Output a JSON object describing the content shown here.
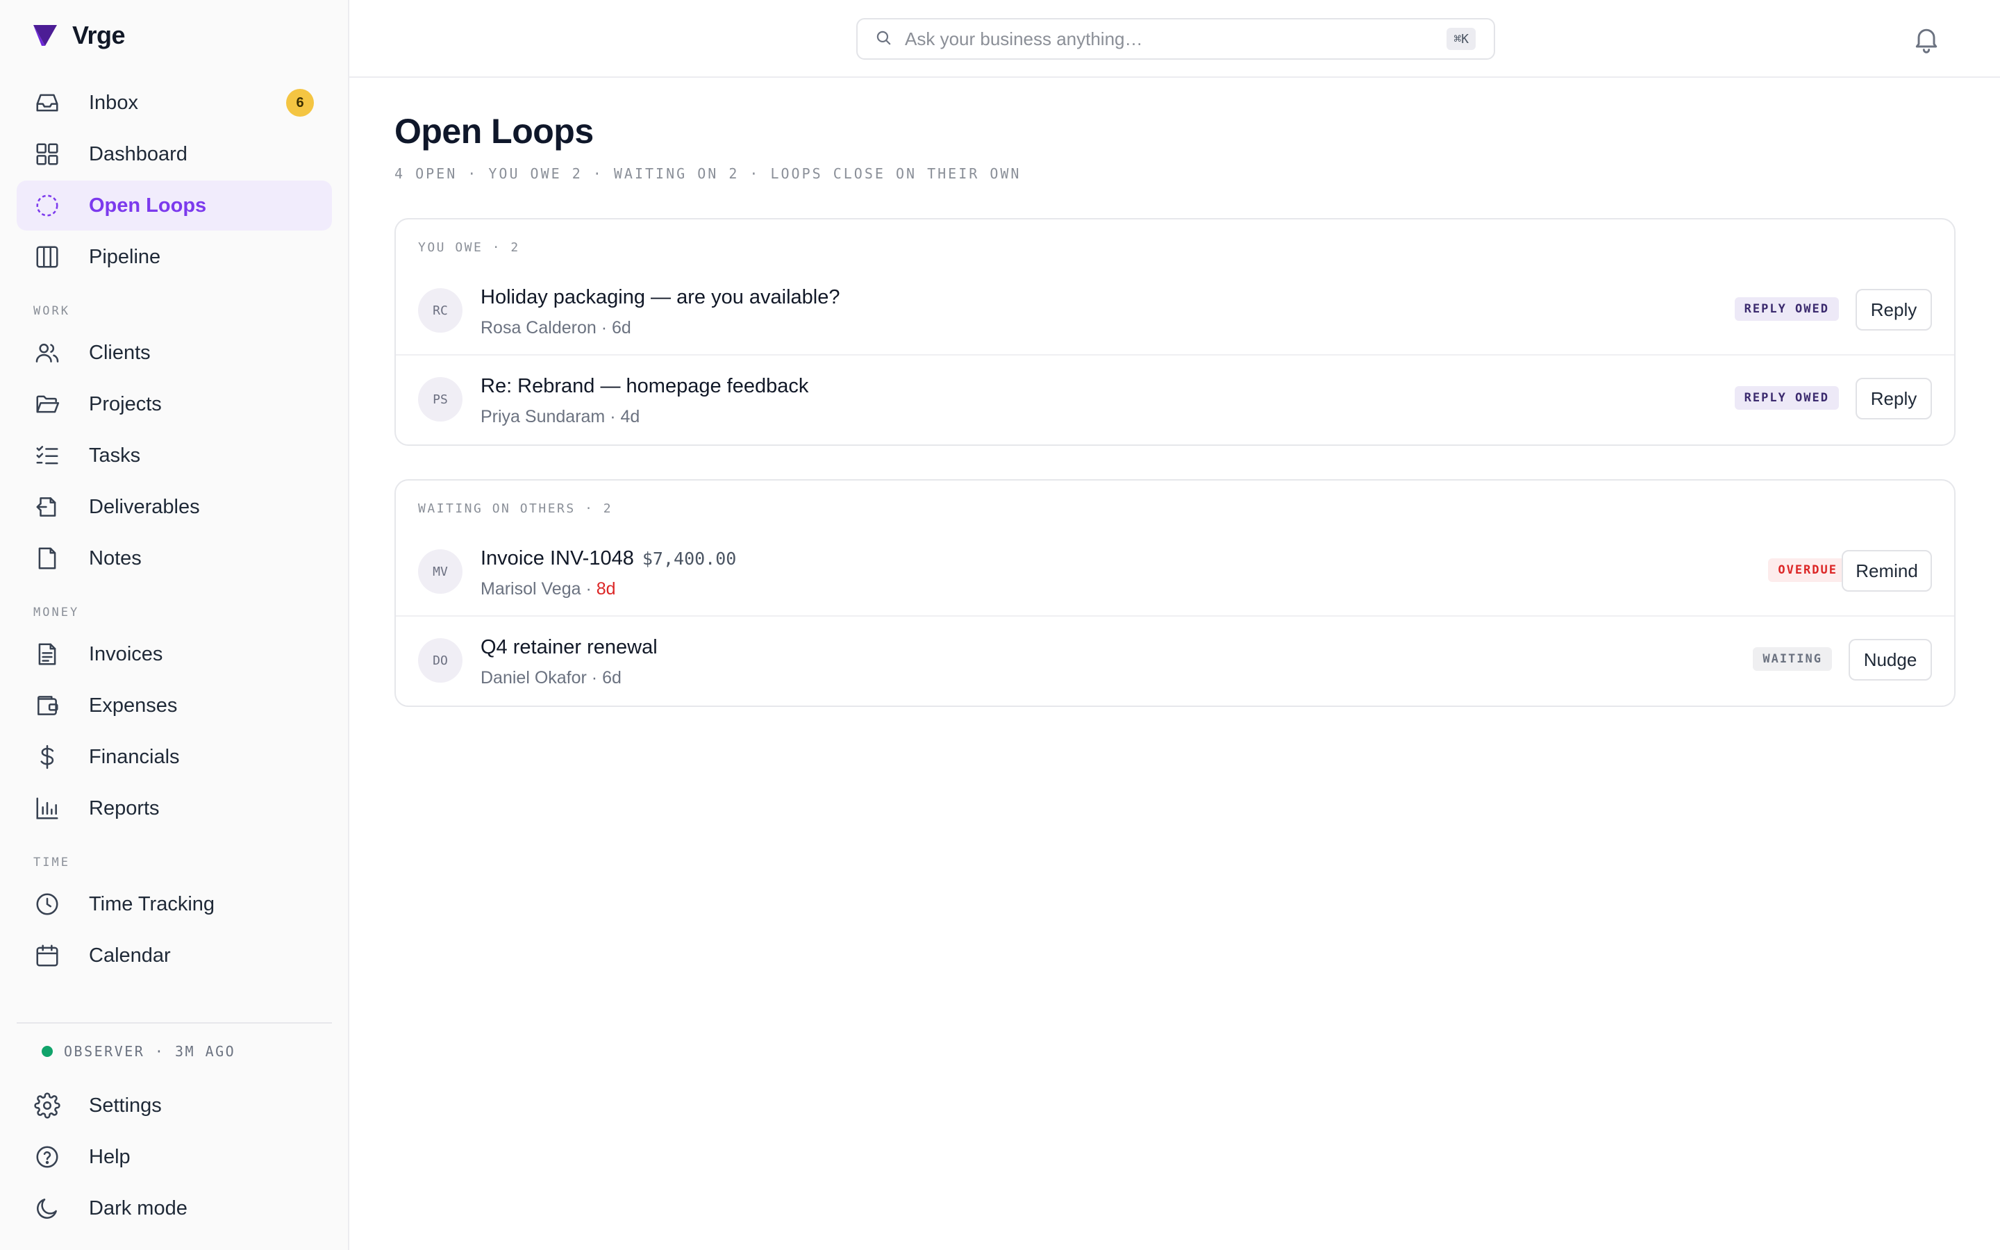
{
  "app": {
    "name": "Vrge"
  },
  "colors": {
    "accent": "#7c3aed",
    "badge": "#f4c542",
    "status_ok": "#10a36a",
    "danger": "#dc2626"
  },
  "sidebar": {
    "nav": [
      {
        "label": "Inbox",
        "icon": "inbox-icon",
        "badge": "6"
      },
      {
        "label": "Dashboard",
        "icon": "grid-icon"
      },
      {
        "label": "Open Loops",
        "icon": "dashed-circle-icon",
        "active": true
      },
      {
        "label": "Pipeline",
        "icon": "columns-icon"
      }
    ],
    "sections": [
      {
        "label": "WORK",
        "items": [
          {
            "label": "Clients",
            "icon": "users-icon"
          },
          {
            "label": "Projects",
            "icon": "folder-open-icon"
          },
          {
            "label": "Tasks",
            "icon": "checklist-icon"
          },
          {
            "label": "Deliverables",
            "icon": "file-export-icon"
          },
          {
            "label": "Notes",
            "icon": "note-icon"
          }
        ]
      },
      {
        "label": "MONEY",
        "items": [
          {
            "label": "Invoices",
            "icon": "invoice-icon"
          },
          {
            "label": "Expenses",
            "icon": "wallet-icon"
          },
          {
            "label": "Financials",
            "icon": "dollar-icon"
          },
          {
            "label": "Reports",
            "icon": "bar-chart-icon"
          }
        ]
      },
      {
        "label": "TIME",
        "items": [
          {
            "label": "Time Tracking",
            "icon": "clock-icon"
          },
          {
            "label": "Calendar",
            "icon": "calendar-icon"
          }
        ]
      }
    ],
    "status": "OBSERVER · 3M AGO",
    "footer": [
      {
        "label": "Settings",
        "icon": "gear-icon"
      },
      {
        "label": "Help",
        "icon": "help-circle-icon"
      },
      {
        "label": "Dark mode",
        "icon": "moon-icon"
      }
    ]
  },
  "topbar": {
    "search": {
      "placeholder": "Ask your business anything…",
      "shortcut": "⌘K"
    }
  },
  "page": {
    "title": "Open Loops",
    "subtitle": "4 OPEN · YOU OWE 2 · WAITING ON 2 · LOOPS CLOSE ON THEIR OWN"
  },
  "groups": [
    {
      "label": "YOU OWE · 2",
      "rows": [
        {
          "initials": "RC",
          "title": "Holiday packaging — are you available?",
          "person": "Rosa Calderon",
          "age": "6d",
          "status": "REPLY OWED",
          "action": "Reply"
        },
        {
          "initials": "PS",
          "title": "Re: Rebrand — homepage feedback",
          "person": "Priya Sundaram",
          "age": "4d",
          "status": "REPLY OWED",
          "action": "Reply"
        }
      ]
    },
    {
      "label": "WAITING ON OTHERS · 2",
      "rows": [
        {
          "initials": "MV",
          "title": "Invoice INV-1048",
          "amount": "$7,400.00",
          "person": "Marisol Vega",
          "age": "8d",
          "status": "OVERDUE",
          "action": "Remind"
        },
        {
          "initials": "DO",
          "title": "Q4 retainer renewal",
          "person": "Daniel Okafor",
          "age": "6d",
          "status": "WAITING",
          "action": "Nudge"
        }
      ]
    }
  ]
}
